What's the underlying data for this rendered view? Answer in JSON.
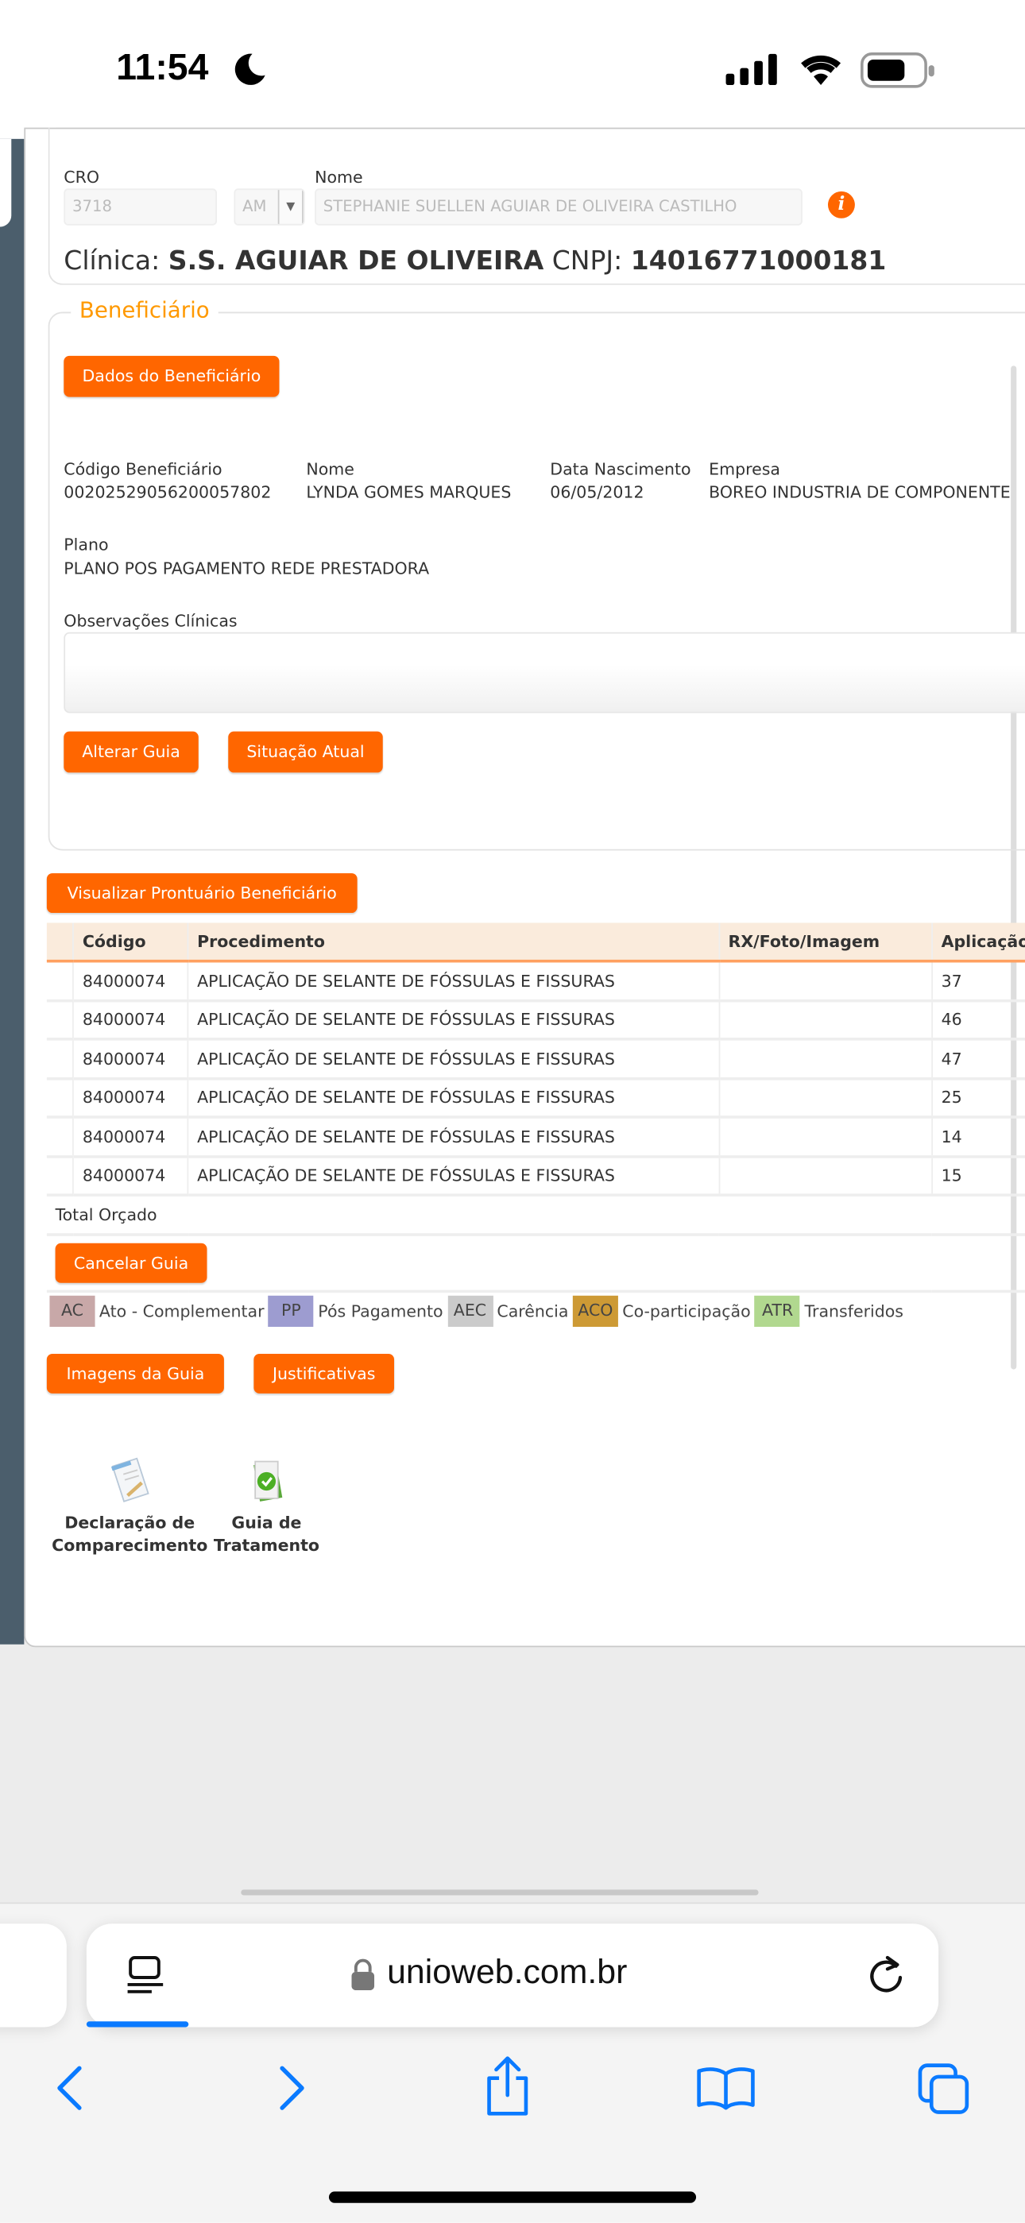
{
  "status_bar": {
    "time": "11:54"
  },
  "professional": {
    "cro_label": "CRO",
    "cro_value": "3718",
    "uf_value": "AM",
    "name_label": "Nome",
    "name_value": "STEPHANIE SUELLEN AGUIAR DE OLIVEIRA CASTILHO",
    "clinic_label": "Clínica:",
    "clinic_name": "S.S. AGUIAR DE OLIVEIRA",
    "cnpj_label": "CNPJ:",
    "cnpj_value": "14016771000181"
  },
  "beneficiary": {
    "legend": "Beneficiário",
    "details_button": "Dados do Beneficiário",
    "code_label": "Código Beneficiário",
    "code_value": "00202529056200057802",
    "name_label": "Nome",
    "name_value": "LYNDA GOMES MARQUES",
    "birth_label": "Data Nascimento",
    "birth_value": "06/05/2012",
    "company_label": "Empresa",
    "company_value": "BOREO INDUSTRIA DE COMPONENTE",
    "plan_label": "Plano",
    "plan_value": "PLANO POS PAGAMENTO REDE PRESTADORA",
    "notes_label": "Observações Clínicas",
    "notes_value": "",
    "alter_button": "Alterar Guia",
    "status_button": "Situação Atual"
  },
  "records_button": "Visualizar Prontuário Beneficiário",
  "table": {
    "headers": [
      "",
      "Código",
      "Procedimento",
      "RX/Foto/Imagem",
      "Aplicação"
    ],
    "rows": [
      {
        "code": "84000074",
        "procedure": "APLICAÇÃO DE SELANTE DE FÓSSULAS E FISSURAS",
        "rx": "",
        "tooth": "37"
      },
      {
        "code": "84000074",
        "procedure": "APLICAÇÃO DE SELANTE DE FÓSSULAS E FISSURAS",
        "rx": "",
        "tooth": "46"
      },
      {
        "code": "84000074",
        "procedure": "APLICAÇÃO DE SELANTE DE FÓSSULAS E FISSURAS",
        "rx": "",
        "tooth": "47"
      },
      {
        "code": "84000074",
        "procedure": "APLICAÇÃO DE SELANTE DE FÓSSULAS E FISSURAS",
        "rx": "",
        "tooth": "25"
      },
      {
        "code": "84000074",
        "procedure": "APLICAÇÃO DE SELANTE DE FÓSSULAS E FISSURAS",
        "rx": "",
        "tooth": "14"
      },
      {
        "code": "84000074",
        "procedure": "APLICAÇÃO DE SELANTE DE FÓSSULAS E FISSURAS",
        "rx": "",
        "tooth": "15"
      }
    ],
    "total_label": "Total Orçado",
    "cancel_button": "Cancelar Guia"
  },
  "legend": [
    {
      "code": "AC",
      "label": "Ato - Complementar",
      "color": "#c8a8a8"
    },
    {
      "code": "PP",
      "label": "Pós Pagamento",
      "color": "#9d9cd0"
    },
    {
      "code": "AEC",
      "label": "Carência",
      "color": "#cbcbcb"
    },
    {
      "code": "ACO",
      "label": "Co-participação",
      "color": "#cd9a35"
    },
    {
      "code": "ATR",
      "label": "Transferidos",
      "color": "#b1d88f"
    }
  ],
  "images_button": "Imagens da Guia",
  "justifications_button": "Justificativas",
  "documents": [
    {
      "line1": "Declaração de",
      "line2": "Comparecimento",
      "icon": "document-pen-icon"
    },
    {
      "line1": "Guia de",
      "line2": "Tratamento",
      "icon": "document-check-icon"
    }
  ],
  "browser": {
    "url": "unioweb.com.br",
    "accent": "#0a7aff"
  }
}
